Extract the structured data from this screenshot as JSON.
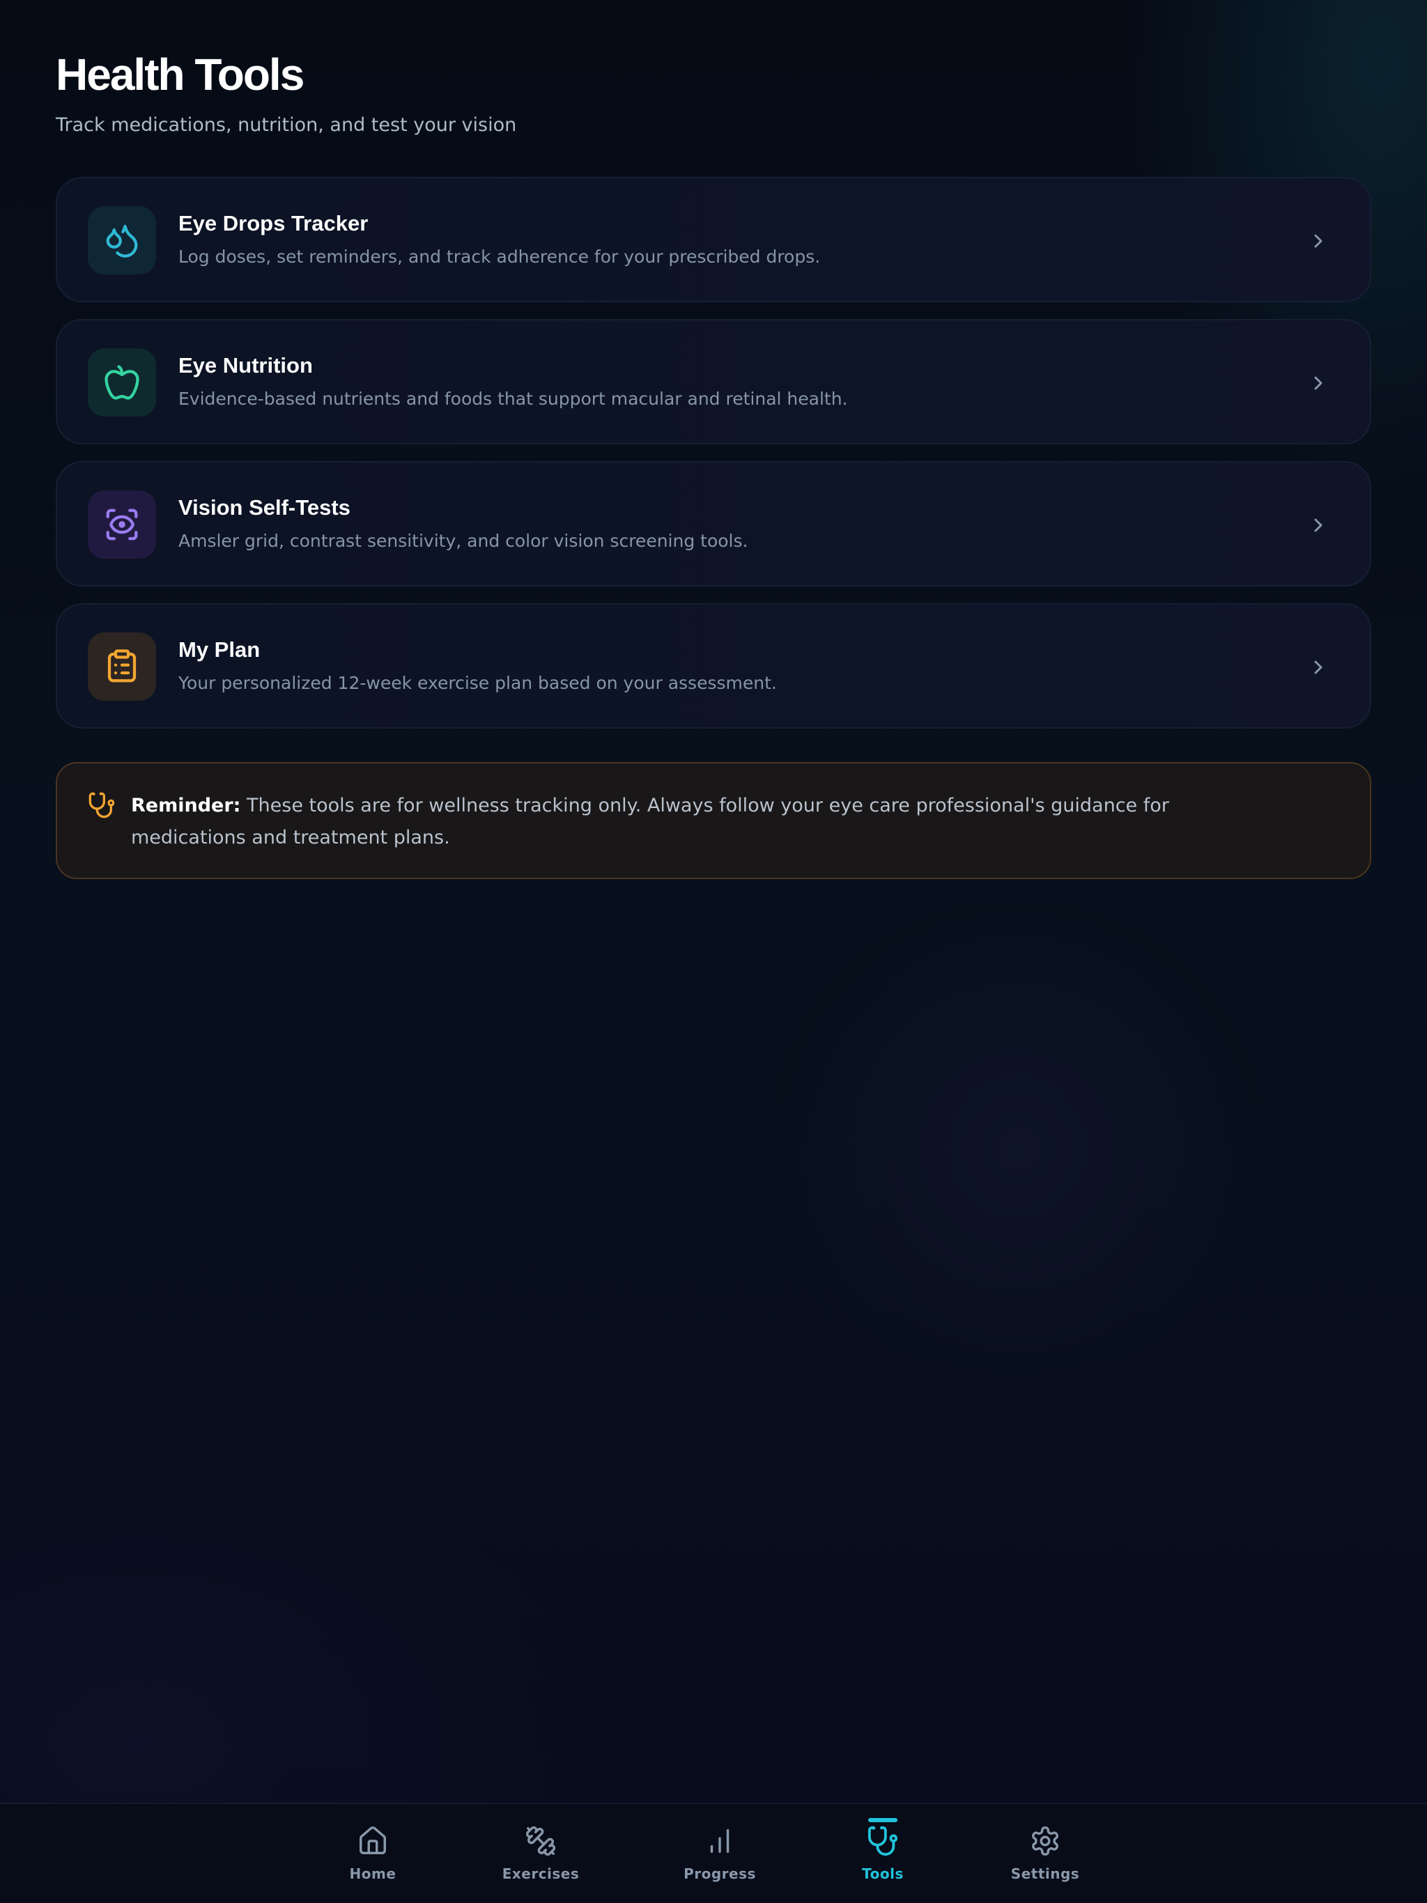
{
  "header": {
    "title": "Health Tools",
    "subtitle": "Track medications, nutrition, and test your vision"
  },
  "tools": [
    {
      "title": "Eye Drops Tracker",
      "description": "Log doses, set reminders, and track adherence for your prescribed drops.",
      "icon": "droplets-icon",
      "accent": "#2fb9d4",
      "icon_bg": "#0f2635"
    },
    {
      "title": "Eye Nutrition",
      "description": "Evidence-based nutrients and foods that support macular and retinal health.",
      "icon": "apple-icon",
      "accent": "#34d3a0",
      "icon_bg": "#0f2a2e"
    },
    {
      "title": "Vision Self-Tests",
      "description": "Amsler grid, contrast sensitivity, and color vision screening tools.",
      "icon": "scan-eye-icon",
      "accent": "#9a7cf0",
      "icon_bg": "#211a40"
    },
    {
      "title": "My Plan",
      "description": "Your personalized 12-week exercise plan based on your assessment.",
      "icon": "clipboard-list-icon",
      "accent": "#f2a531",
      "icon_bg": "#2c2522"
    }
  ],
  "reminder": {
    "label": "Reminder:",
    "text": " These tools are for wellness tracking only. Always follow your eye care professional's guidance for medications and treatment plans.",
    "icon": "stethoscope-icon",
    "accent": "#f2a531"
  },
  "tabbar": {
    "active": "Tools",
    "active_color": "#22c3dc",
    "items": [
      {
        "label": "Home",
        "icon": "home-icon"
      },
      {
        "label": "Exercises",
        "icon": "dumbbell-icon"
      },
      {
        "label": "Progress",
        "icon": "bar-chart-icon"
      },
      {
        "label": "Tools",
        "icon": "stethoscope-icon"
      },
      {
        "label": "Settings",
        "icon": "gear-icon"
      }
    ]
  }
}
